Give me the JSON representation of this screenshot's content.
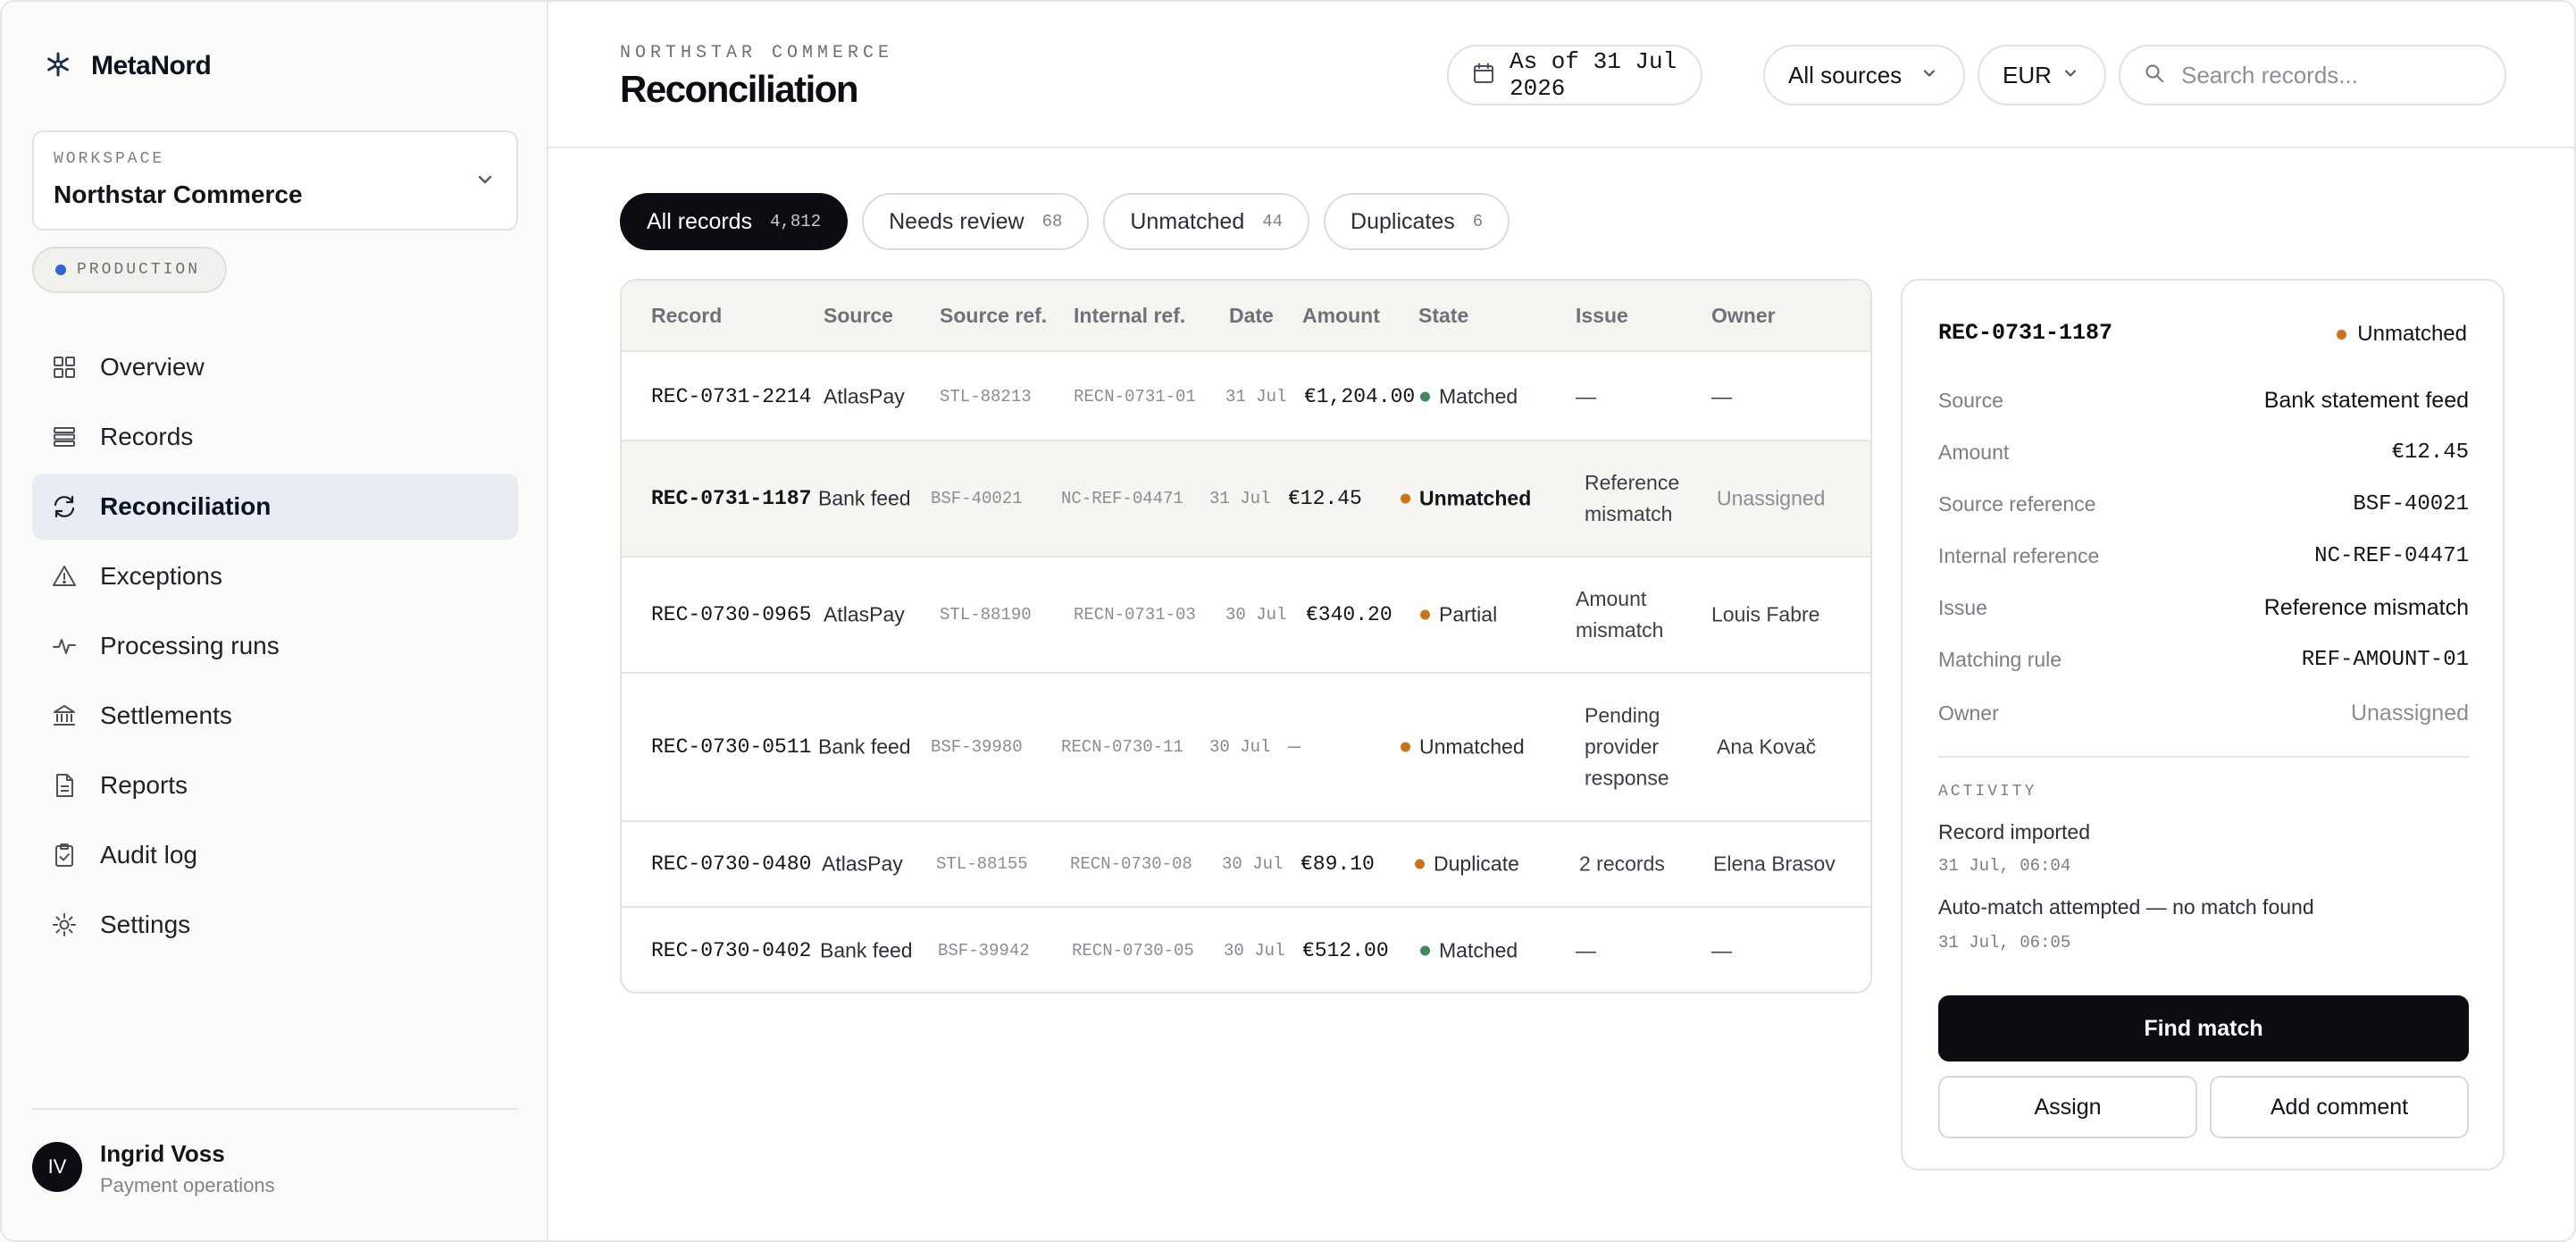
{
  "brand": {
    "name": "MetaNord"
  },
  "workspace": {
    "label": "WORKSPACE",
    "name": "Northstar Commerce",
    "environment": "PRODUCTION"
  },
  "sidebar": {
    "items": [
      {
        "label": "Overview",
        "icon": "grid-icon"
      },
      {
        "label": "Records",
        "icon": "stack-icon"
      },
      {
        "label": "Reconciliation",
        "icon": "refresh-icon",
        "active": true
      },
      {
        "label": "Exceptions",
        "icon": "warning-icon"
      },
      {
        "label": "Processing runs",
        "icon": "pulse-icon"
      },
      {
        "label": "Settlements",
        "icon": "bank-icon"
      },
      {
        "label": "Reports",
        "icon": "document-icon"
      },
      {
        "label": "Audit log",
        "icon": "clipboard-check-icon"
      },
      {
        "label": "Settings",
        "icon": "gear-icon"
      }
    ]
  },
  "user": {
    "initials": "IV",
    "name": "Ingrid Voss",
    "role": "Payment operations"
  },
  "header": {
    "eyebrow": "NORTHSTAR COMMERCE",
    "title": "Reconciliation",
    "date_filter": "As of 31 Jul 2026",
    "source_filter": "All sources",
    "currency": "EUR",
    "search_placeholder": "Search records..."
  },
  "tabs": [
    {
      "label": "All records",
      "count": "4,812",
      "active": true
    },
    {
      "label": "Needs review",
      "count": "68"
    },
    {
      "label": "Unmatched",
      "count": "44"
    },
    {
      "label": "Duplicates",
      "count": "6"
    }
  ],
  "table": {
    "columns": [
      "Record",
      "Source",
      "Source ref.",
      "Internal ref.",
      "Date",
      "Amount",
      "State",
      "Issue",
      "Owner"
    ],
    "rows": [
      {
        "record": "REC-0731-2214",
        "source": "AtlasPay",
        "source_ref": "STL-88213",
        "internal_ref": "RECN-0731-01",
        "date": "31 Jul",
        "amount": "€1,204.00",
        "state": "Matched",
        "issue": "—",
        "owner": "—"
      },
      {
        "record": "REC-0731-1187",
        "source": "Bank feed",
        "source_ref": "BSF-40021",
        "internal_ref": "NC-REF-04471",
        "date": "31 Jul",
        "amount": "€12.45",
        "state": "Unmatched",
        "issue": "Reference mismatch",
        "owner": "Unassigned"
      },
      {
        "record": "REC-0730-0965",
        "source": "AtlasPay",
        "source_ref": "STL-88190",
        "internal_ref": "RECN-0731-03",
        "date": "30 Jul",
        "amount": "€340.20",
        "state": "Partial",
        "issue": "Amount mismatch",
        "owner": "Louis Fabre"
      },
      {
        "record": "REC-0730-0511",
        "source": "Bank feed",
        "source_ref": "BSF-39980",
        "internal_ref": "RECN-0730-11",
        "date": "30 Jul",
        "amount": "—",
        "state": "Unmatched",
        "issue": "Pending provider response",
        "owner": "Ana Kovač"
      },
      {
        "record": "REC-0730-0480",
        "source": "AtlasPay",
        "source_ref": "STL-88155",
        "internal_ref": "RECN-0730-08",
        "date": "30 Jul",
        "amount": "€89.10",
        "state": "Duplicate",
        "issue": "2 records",
        "owner": "Elena Brasov"
      },
      {
        "record": "REC-0730-0402",
        "source": "Bank feed",
        "source_ref": "BSF-39942",
        "internal_ref": "RECN-0730-05",
        "date": "30 Jul",
        "amount": "€512.00",
        "state": "Matched",
        "issue": "—",
        "owner": "—"
      }
    ]
  },
  "detail": {
    "record": "REC-0731-1187",
    "state": "Unmatched",
    "fields": [
      {
        "label": "Source",
        "value": "Bank statement feed"
      },
      {
        "label": "Amount",
        "value": "€12.45"
      },
      {
        "label": "Source reference",
        "value": "BSF-40021"
      },
      {
        "label": "Internal reference",
        "value": "NC-REF-04471"
      },
      {
        "label": "Issue",
        "value": "Reference mismatch"
      },
      {
        "label": "Matching rule",
        "value": "REF-AMOUNT-01"
      },
      {
        "label": "Owner",
        "value": "Unassigned"
      }
    ],
    "activity_label": "ACTIVITY",
    "activity": [
      {
        "text": "Record imported",
        "time": "31 Jul, 06:04"
      },
      {
        "text": "Auto-match attempted — no match found",
        "time": "31 Jul, 06:05"
      }
    ],
    "primary_action": "Find match",
    "secondary_actions": [
      "Assign",
      "Add comment"
    ]
  },
  "colors": {
    "matched": "#3f8a5b",
    "unmatched": "#c9741a",
    "partial": "#c9741a",
    "duplicate": "#c9741a",
    "accent": "#0b0d12",
    "environment_dot": "#2f66d0"
  }
}
